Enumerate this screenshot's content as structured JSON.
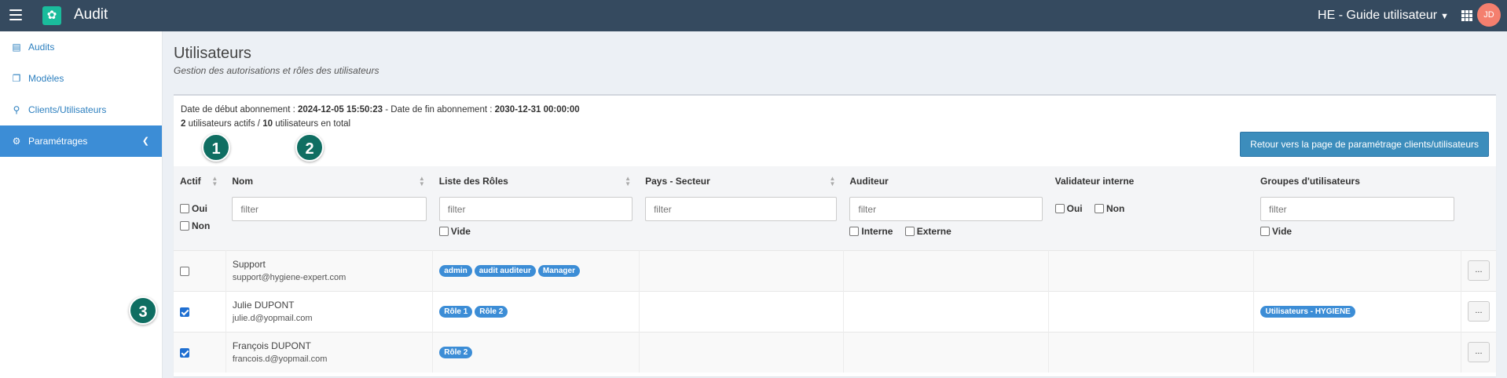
{
  "app": {
    "title": "Audit",
    "org": "HE - Guide utilisateur",
    "avatar_initials": "JD",
    "logo_icon": "settings-cog-icon"
  },
  "colors": {
    "topbar": "#354a5f",
    "accent": "#3c8dd6",
    "logo": "#1abc9c",
    "avatar": "#f47f6e",
    "marker": "#0f6e62"
  },
  "sidebar": {
    "items": [
      {
        "label": "Audits",
        "icon": "document-icon"
      },
      {
        "label": "Modèles",
        "icon": "copy-icon"
      },
      {
        "label": "Clients/Utilisateurs",
        "icon": "map-pin-icon"
      },
      {
        "label": "Paramétrages",
        "icon": "cogs-icon",
        "active": true
      }
    ]
  },
  "page": {
    "title": "Utilisateurs",
    "subtitle": "Gestion des autorisations et rôles des utilisateurs"
  },
  "subscription": {
    "start_label": "Date de début abonnement :",
    "start": "2024-12-05 15:50:23",
    "end_label": "- Date de fin abonnement :",
    "end": "2030-12-31 00:00:00",
    "active_count": "2",
    "active_label": "utilisateurs actifs /",
    "total_count": "10",
    "total_label": "utilisateurs en total"
  },
  "return_button": "Retour vers la page de paramétrage clients/utilisateurs",
  "markers": [
    "1",
    "2",
    "3"
  ],
  "table": {
    "columns": [
      "Actif",
      "Nom",
      "Liste des Rôles",
      "Pays - Secteur",
      "Auditeur",
      "Validateur interne",
      "Groupes d'utilisateurs"
    ],
    "filter_placeholder": "filter",
    "opt_oui": "Oui",
    "opt_non": "Non",
    "opt_vide": "Vide",
    "opt_interne": "Interne",
    "opt_externe": "Externe",
    "more_label": "...",
    "rows": [
      {
        "active": false,
        "name": "Support",
        "email": "support@hygiene-expert.com",
        "roles": [
          "admin",
          "audit auditeur",
          "Manager"
        ],
        "groups": []
      },
      {
        "active": true,
        "name": "Julie DUPONT",
        "email": "julie.d@yopmail.com",
        "roles": [
          "Rôle 1",
          "Rôle 2"
        ],
        "groups": [
          "Utilisateurs - HYGIENE"
        ]
      },
      {
        "active": true,
        "name": "François DUPONT",
        "email": "francois.d@yopmail.com",
        "roles": [
          "Rôle 2"
        ],
        "groups": []
      }
    ]
  }
}
